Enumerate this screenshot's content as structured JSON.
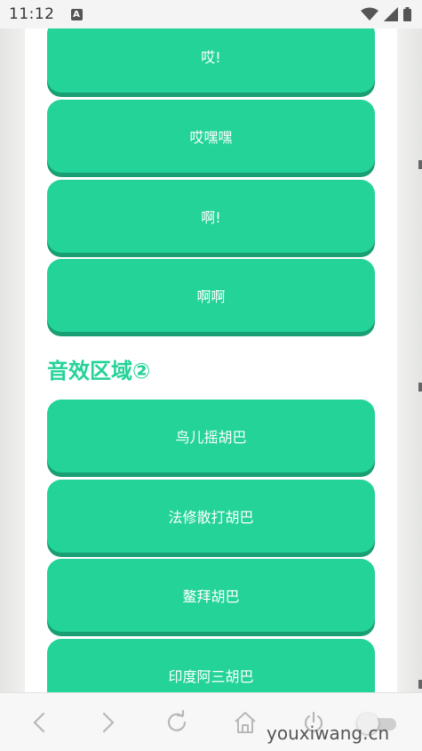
{
  "status_bar": {
    "time": "11:12",
    "notification_icon": "a-notification-icon",
    "wifi_icon": "wifi-icon",
    "signal_icon": "signal-icon",
    "battery_icon": "battery-icon"
  },
  "content": {
    "section1_buttons": [
      {
        "label": "哎!"
      },
      {
        "label": "哎嘿嘿"
      },
      {
        "label": "啊!"
      },
      {
        "label": "啊啊"
      }
    ],
    "section2_title": "音效区域②",
    "section2_buttons": [
      {
        "label": "鸟儿摇胡巴"
      },
      {
        "label": "法修散打胡巴"
      },
      {
        "label": "鳌拜胡巴"
      },
      {
        "label": "印度阿三胡巴"
      }
    ]
  },
  "bottom_nav": {
    "back_icon": "chevron-left-icon",
    "forward_icon": "chevron-right-icon",
    "refresh_icon": "refresh-icon",
    "home_icon": "home-icon",
    "power_icon": "power-icon",
    "toggle_icon": "toggle-switch-icon"
  },
  "watermark": "youxiwang.cn",
  "colors": {
    "accent": "#23d398",
    "accent_shadow": "#1a9e73",
    "button_text": "#ffffff",
    "page_bg": "#ffffff"
  }
}
